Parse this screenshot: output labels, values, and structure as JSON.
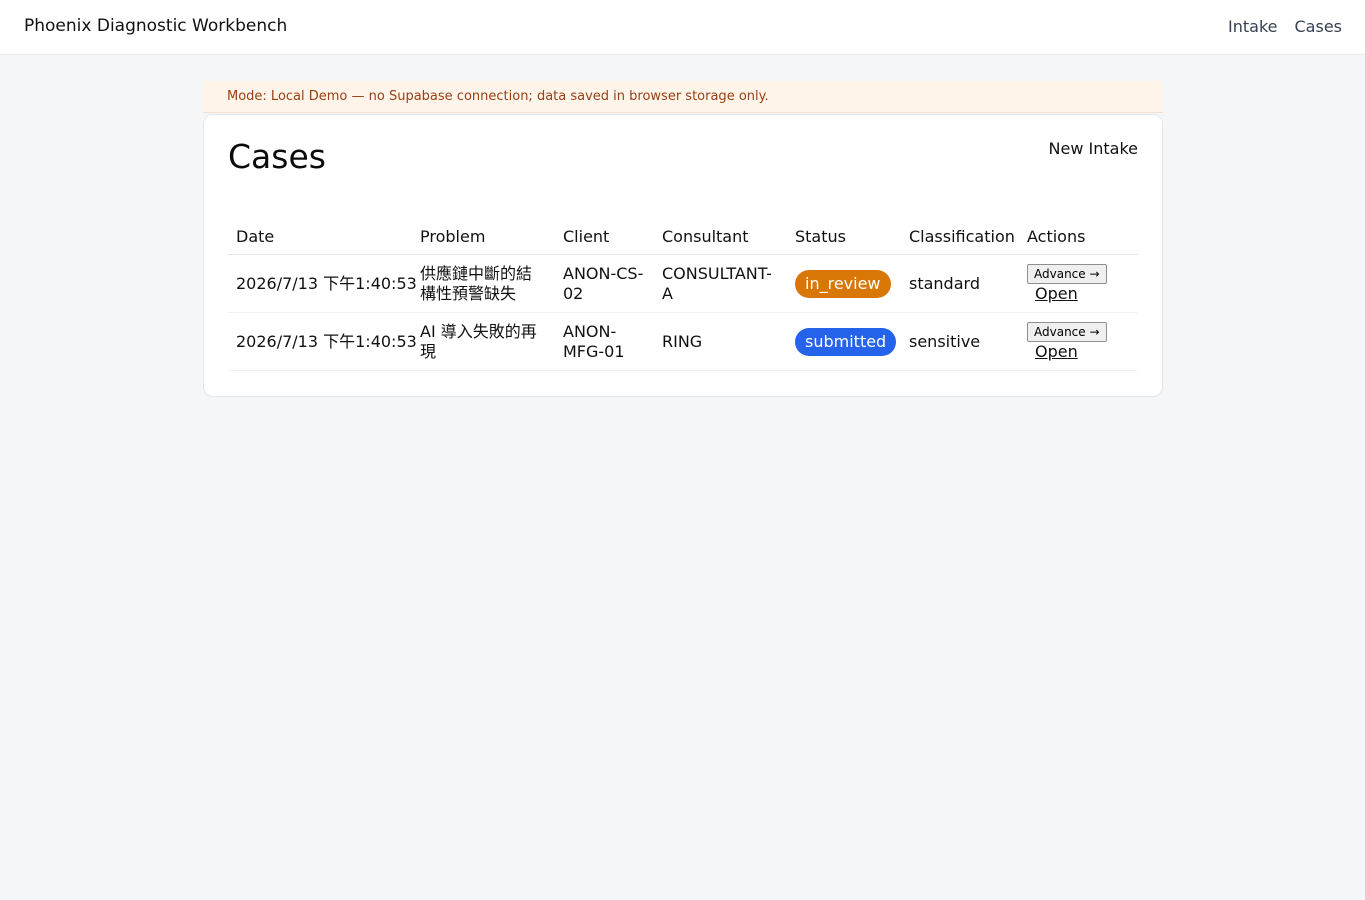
{
  "header": {
    "title": "Phoenix Diagnostic Workbench",
    "nav": [
      "Intake",
      "Cases"
    ]
  },
  "banner": {
    "text": "Mode: Local Demo — no Supabase connection; data saved in browser storage only."
  },
  "page": {
    "title": "Cases",
    "new_intake_label": "New Intake"
  },
  "table": {
    "columns": [
      "Date",
      "Problem",
      "Client",
      "Consultant",
      "Status",
      "Classification",
      "Actions"
    ],
    "rows": [
      {
        "date": "2026/7/13 下午1:40:53",
        "problem": "供應鏈中斷的結構性預警缺失",
        "client": "ANON-CS-02",
        "consultant": "CONSULTANT-A",
        "status": "in_review",
        "status_color": "#d97706",
        "classification": "standard",
        "advance_label": "Advance →",
        "open_label": "Open"
      },
      {
        "date": "2026/7/13 下午1:40:53",
        "problem": "AI 導入失敗的再現",
        "client": "ANON-MFG-01",
        "consultant": "RING",
        "status": "submitted",
        "status_color": "#2563eb",
        "classification": "sensitive",
        "advance_label": "Advance →",
        "open_label": "Open"
      }
    ]
  }
}
